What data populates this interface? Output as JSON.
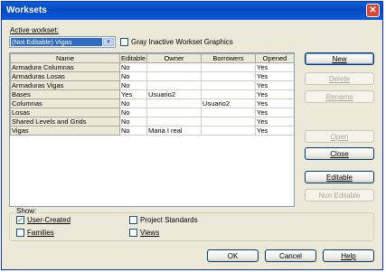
{
  "window": {
    "title": "Worksets",
    "close_glyph": "✕"
  },
  "active_workset": {
    "label": "Active workset:",
    "selected": "(Not Editable) Vigas",
    "gray_inactive_label": "Gray Inactive Workset Graphics",
    "gray_inactive_checked": false
  },
  "table": {
    "columns": [
      "Name",
      "Editable",
      "Owner",
      "Borrowers",
      "Opened"
    ],
    "rows": [
      {
        "name": "Armadura Columnas",
        "editable": "No",
        "owner": "",
        "borrowers": "",
        "opened": "Yes"
      },
      {
        "name": "Armaduras Losas",
        "editable": "No",
        "owner": "",
        "borrowers": "",
        "opened": "Yes"
      },
      {
        "name": "Armaduras Vigas",
        "editable": "No",
        "owner": "",
        "borrowers": "",
        "opened": "Yes"
      },
      {
        "name": "Bases",
        "editable": "Yes",
        "owner": "Usuario2",
        "borrowers": "",
        "opened": "Yes"
      },
      {
        "name": "Columnas",
        "editable": "No",
        "owner": "",
        "borrowers": "Usuario2",
        "opened": "Yes"
      },
      {
        "name": "Losas",
        "editable": "No",
        "owner": "",
        "borrowers": "",
        "opened": "Yes"
      },
      {
        "name": "Shared Levels and Grids",
        "editable": "No",
        "owner": "",
        "borrowers": "",
        "opened": "Yes"
      },
      {
        "name": "Vigas",
        "editable": "No",
        "owner": "Maria I real",
        "borrowers": "",
        "opened": "Yes"
      }
    ]
  },
  "side_buttons": {
    "new": "New",
    "delete": "Delete",
    "rename": "Rename",
    "open": "Open",
    "close": "Close",
    "editable": "Editable",
    "non_editable": "Non Editable"
  },
  "show": {
    "legend": "Show:",
    "user_created": "User-Created",
    "user_created_checked": true,
    "families": "Families",
    "families_checked": false,
    "project_standards": "Project Standards",
    "project_standards_checked": false,
    "views": "Views",
    "views_checked": false
  },
  "footer": {
    "ok": "OK",
    "cancel": "Cancel",
    "help": "Help"
  }
}
